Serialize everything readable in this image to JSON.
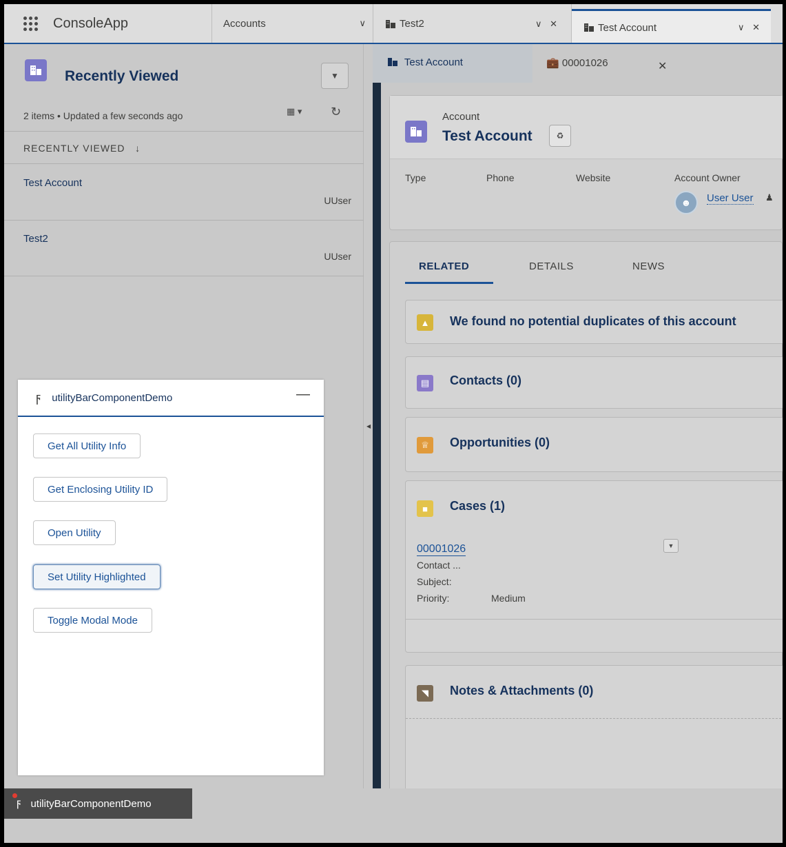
{
  "app": {
    "name": "ConsoleApp",
    "nav_label": "Accounts",
    "workspace_tabs": [
      {
        "label": "Test2"
      },
      {
        "label": "Test Account"
      }
    ]
  },
  "subtabs": [
    {
      "label": "Test Account"
    },
    {
      "label": "00001026"
    }
  ],
  "list_view": {
    "title": "Recently Viewed",
    "meta": "2 items • Updated a few seconds ago",
    "column_header": "RECENTLY VIEWED",
    "rows": [
      {
        "name": "Test Account",
        "owner": "UUser"
      },
      {
        "name": "Test2",
        "owner": "UUser"
      }
    ]
  },
  "utility": {
    "title": "utilityBarComponentDemo",
    "buttons": [
      "Get All Utility Info",
      "Get Enclosing Utility ID",
      "Open Utility",
      "Set Utility Highlighted",
      "Toggle Modal Mode"
    ]
  },
  "record": {
    "object_label": "Account",
    "name": "Test Account",
    "fields": {
      "type": "Type",
      "phone": "Phone",
      "website": "Website",
      "owner_label": "Account Owner",
      "owner_value": "User User"
    },
    "tabs": [
      "RELATED",
      "DETAILS",
      "NEWS"
    ],
    "duplicates_msg": "We found no potential duplicates of this account",
    "contacts": "Contacts (0)",
    "opportunities": "Opportunities (0)",
    "cases": {
      "title": "Cases (1)",
      "number": "00001026",
      "contact_label": "Contact ...",
      "subject_label": "Subject:",
      "priority_label": "Priority:",
      "priority_value": "Medium"
    },
    "notes": "Notes & Attachments (0)"
  },
  "utility_bar": {
    "item": "utilityBarComponentDemo"
  },
  "colors": {
    "brand": "#1b5297",
    "account_icon": "#7a77c8",
    "duplicate_icon": "#d7b53a",
    "contact_icon": "#8a79c9",
    "opportunity_icon": "#e09a3b",
    "case_icon": "#e3c34b",
    "notes_icon": "#7b6a54"
  }
}
